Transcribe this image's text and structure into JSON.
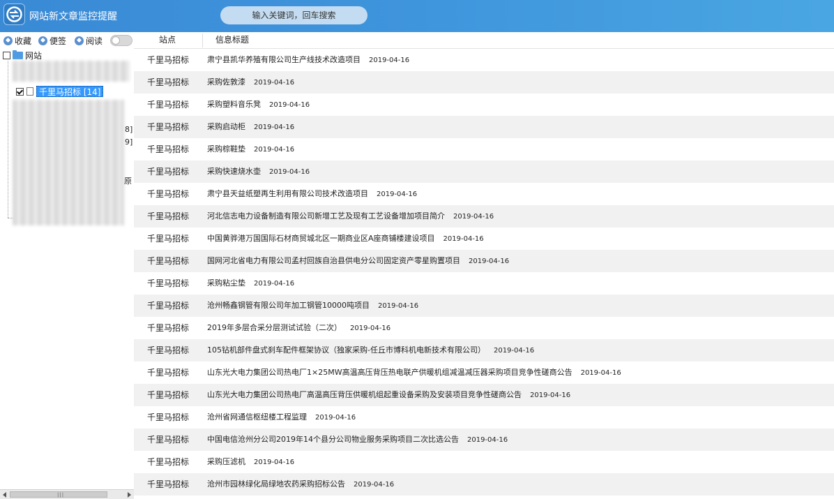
{
  "app": {
    "title": "网站新文章监控提醒",
    "search_placeholder": "输入关键词，回车搜索"
  },
  "toolbar": {
    "favorites": "收藏",
    "notes": "便签",
    "read": "阅读"
  },
  "tree": {
    "root_label": "网站",
    "selected_item": "千里马招标 [14]",
    "fragments": [
      "8]",
      "9]",
      "原"
    ]
  },
  "table": {
    "headers": {
      "site": "站点",
      "title": "信息标题"
    },
    "rows": [
      {
        "site": "千里马招标",
        "title": "肃宁县凯华养殖有限公司生产线技术改造项目",
        "date": "2019-04-16"
      },
      {
        "site": "千里马招标",
        "title": "采购佐敦漆",
        "date": "2019-04-16"
      },
      {
        "site": "千里马招标",
        "title": "采购塑料音乐凳",
        "date": "2019-04-16"
      },
      {
        "site": "千里马招标",
        "title": "采购启动柜",
        "date": "2019-04-16"
      },
      {
        "site": "千里马招标",
        "title": "采购棕鞋垫",
        "date": "2019-04-16"
      },
      {
        "site": "千里马招标",
        "title": "采购快速烧水壶",
        "date": "2019-04-16"
      },
      {
        "site": "千里马招标",
        "title": "肃宁县天益纸塑再生利用有限公司技术改造项目",
        "date": "2019-04-16"
      },
      {
        "site": "千里马招标",
        "title": "河北信志电力设备制造有限公司新增工艺及现有工艺设备增加项目简介",
        "date": "2019-04-16"
      },
      {
        "site": "千里马招标",
        "title": "中国黄骅港万国国际石材商贸城北区一期商业区A座商铺楼建设项目",
        "date": "2019-04-16"
      },
      {
        "site": "千里马招标",
        "title": "国网河北省电力有限公司孟村回族自治县供电分公司固定资产零星购置项目",
        "date": "2019-04-16"
      },
      {
        "site": "千里马招标",
        "title": "采购粘尘垫",
        "date": "2019-04-16"
      },
      {
        "site": "千里马招标",
        "title": "沧州畅鑫钢管有限公司年加工钢管10000吨项目",
        "date": "2019-04-16"
      },
      {
        "site": "千里马招标",
        "title": "2019年多层合采分层测试试验（二次）",
        "date": "2019-04-16"
      },
      {
        "site": "千里马招标",
        "title": "105钻机部件盘式刹车配件框架协议（独家采购-任丘市博科机电新技术有限公司）",
        "date": "2019-04-16"
      },
      {
        "site": "千里马招标",
        "title": "山东光大电力集团公司热电厂1×25MW高温高压背压热电联产供暖机组减温减压器采购项目竞争性磋商公告",
        "date": "2019-04-16"
      },
      {
        "site": "千里马招标",
        "title": "山东光大电力集团公司热电厂高温高压背压供暖机组起重设备采购及安装项目竞争性磋商公告",
        "date": "2019-04-16"
      },
      {
        "site": "千里马招标",
        "title": "沧州省网通信枢纽楼工程监理",
        "date": "2019-04-16"
      },
      {
        "site": "千里马招标",
        "title": "中国电信沧州分公司2019年14个县分公司物业服务采购项目二次比选公告",
        "date": "2019-04-16"
      },
      {
        "site": "千里马招标",
        "title": "采购压滤机",
        "date": "2019-04-16"
      },
      {
        "site": "千里马招标",
        "title": "沧州市园林绿化局绿地农药采购招标公告",
        "date": "2019-04-16"
      }
    ]
  }
}
